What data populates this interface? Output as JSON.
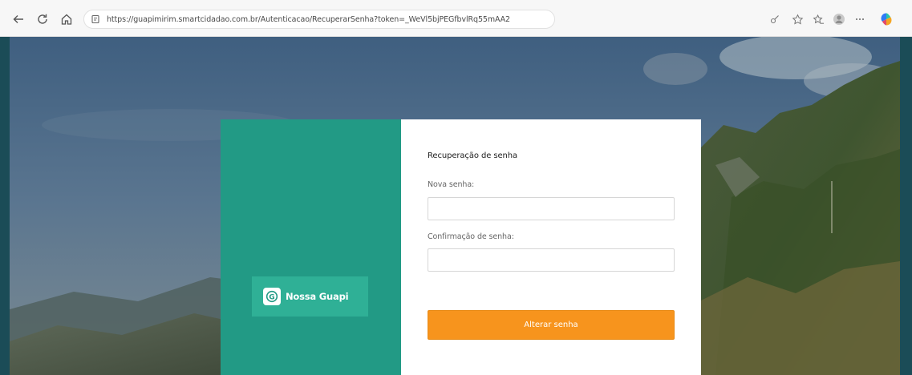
{
  "browser": {
    "url": "https://guapimirim.smartcidadao.com.br/Autenticacao/RecuperarSenha?token=_WeVl5bjPEGfbvlRq55mAA2",
    "icons": [
      "back-icon",
      "refresh-icon",
      "home-icon",
      "site-info-icon",
      "read-aloud-icon",
      "favorite-icon",
      "favorites-bar-icon",
      "profile-icon",
      "more-icon",
      "copilot-icon"
    ]
  },
  "brand": {
    "name": "Nossa Guapi",
    "logo_letter": "G"
  },
  "form": {
    "title": "Recuperação de senha",
    "new_password_label": "Nova senha:",
    "new_password_value": "",
    "confirm_password_label": "Confirmação de senha:",
    "confirm_password_value": "",
    "submit_label": "Alterar senha"
  },
  "colors": {
    "brand_panel": "#229a85",
    "logo_box": "#2fb096",
    "submit_button": "#f7941d",
    "page_frame": "#1b4c57"
  }
}
